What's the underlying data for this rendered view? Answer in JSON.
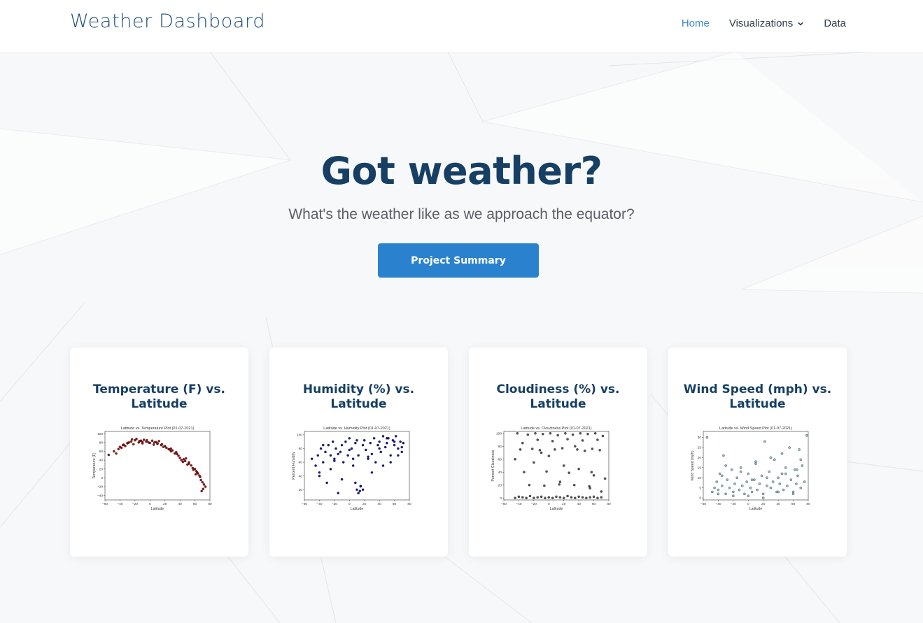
{
  "header": {
    "brand": "Weather Dashboard",
    "nav": [
      {
        "label": "Home",
        "active": true
      },
      {
        "label": "Visualizations",
        "dropdown": true
      },
      {
        "label": "Data"
      }
    ]
  },
  "hero": {
    "title": "Got weather?",
    "subtitle": "What's the weather like as we approach the equator?",
    "cta_label": "Project Summary"
  },
  "colors": {
    "brand": "#1e4d7b",
    "accent": "#2a82cf",
    "heading": "#163f63",
    "nav_active": "#3b87cf"
  },
  "cards": [
    {
      "title_line1": "Temperature (F) vs.",
      "title_line2": "Latitude"
    },
    {
      "title_line1": "Humidity (%) vs.",
      "title_line2": "Latitude"
    },
    {
      "title_line1": "Cloudiness (%) vs.",
      "title_line2": "Latitude"
    },
    {
      "title_line1": "Wind Speed (mph) vs.",
      "title_line2": "Latitude"
    }
  ],
  "chart_data": [
    {
      "type": "scatter",
      "title": "Latitude vs. Temperature Plot (01-07-2021)",
      "xlabel": "Latitude",
      "ylabel": "Temperature (F)",
      "xlim": [
        -60,
        80
      ],
      "ylim": [
        -50,
        105
      ],
      "xticks": [
        -60,
        -40,
        -20,
        0,
        20,
        40,
        60,
        80
      ],
      "yticks": [
        -40,
        -20,
        0,
        20,
        40,
        60,
        80,
        100
      ],
      "marker_color": "#8b0000",
      "x": [
        -55,
        -48,
        -45,
        -42,
        -40,
        -38,
        -35,
        -33,
        -30,
        -28,
        -25,
        -22,
        -20,
        -18,
        -15,
        -12,
        -10,
        -8,
        -5,
        -2,
        0,
        3,
        5,
        8,
        10,
        12,
        15,
        18,
        20,
        22,
        25,
        28,
        30,
        33,
        35,
        38,
        40,
        42,
        45,
        47,
        50,
        52,
        55,
        57,
        60,
        62,
        64,
        66,
        68,
        70,
        72,
        74,
        -36,
        -24,
        -14,
        -4,
        6,
        16,
        26,
        36,
        44,
        52,
        58,
        63,
        67,
        71,
        -30,
        -10,
        10,
        28,
        48,
        61,
        69
      ],
      "y": [
        52,
        60,
        55,
        65,
        70,
        68,
        75,
        72,
        78,
        80,
        82,
        76,
        85,
        88,
        80,
        84,
        78,
        86,
        82,
        80,
        79,
        84,
        75,
        81,
        77,
        83,
        74,
        70,
        72,
        68,
        65,
        60,
        62,
        55,
        58,
        50,
        45,
        40,
        42,
        38,
        30,
        35,
        28,
        22,
        20,
        15,
        10,
        5,
        -5,
        -10,
        -15,
        -20,
        74,
        87,
        83,
        85,
        80,
        76,
        64,
        54,
        36,
        32,
        18,
        12,
        2,
        -25,
        79,
        81,
        78,
        66,
        44,
        8,
        -30
      ]
    },
    {
      "type": "scatter",
      "title": "Latitude vs. Humidity Plot (01-07-2021)",
      "xlabel": "Latitude",
      "ylabel": "Percent Humidity",
      "xlim": [
        -60,
        80
      ],
      "ylim": [
        5,
        105
      ],
      "xticks": [
        -60,
        -40,
        -20,
        0,
        20,
        40,
        60,
        80
      ],
      "yticks": [
        20,
        40,
        60,
        80,
        100
      ],
      "marker_color": "#00008b",
      "x": [
        -50,
        -45,
        -42,
        -40,
        -38,
        -35,
        -32,
        -30,
        -28,
        -25,
        -22,
        -20,
        -18,
        -15,
        -12,
        -10,
        -8,
        -5,
        -2,
        0,
        3,
        5,
        8,
        10,
        12,
        15,
        18,
        20,
        22,
        25,
        28,
        30,
        33,
        35,
        38,
        40,
        42,
        45,
        48,
        50,
        52,
        55,
        58,
        60,
        62,
        65,
        68,
        70,
        72,
        -40,
        -25,
        -10,
        5,
        12,
        18,
        30,
        45,
        55,
        65,
        -35,
        -15,
        0,
        10,
        15,
        25,
        40,
        50,
        60,
        70,
        -20,
        8,
        14
      ],
      "y": [
        65,
        55,
        70,
        45,
        80,
        60,
        75,
        30,
        85,
        70,
        90,
        65,
        80,
        15,
        75,
        85,
        60,
        90,
        70,
        95,
        80,
        55,
        88,
        20,
        70,
        25,
        85,
        92,
        78,
        65,
        88,
        72,
        95,
        60,
        85,
        90,
        75,
        98,
        82,
        88,
        95,
        70,
        92,
        85,
        98,
        80,
        90,
        75,
        88,
        40,
        50,
        35,
        65,
        15,
        20,
        45,
        55,
        60,
        70,
        85,
        72,
        78,
        92,
        25,
        68,
        80,
        95,
        90,
        82,
        62,
        30,
        18
      ]
    },
    {
      "type": "scatter",
      "title": "Latitude vs. Cloudiness Plot (01-07-2021)",
      "xlabel": "Latitude",
      "ylabel": "Percent Cloudiness",
      "xlim": [
        -60,
        80
      ],
      "ylim": [
        -3,
        103
      ],
      "xticks": [
        -60,
        -40,
        -20,
        0,
        20,
        40,
        60,
        80
      ],
      "yticks": [
        0,
        20,
        40,
        60,
        80,
        100
      ],
      "marker_color": "#444444",
      "x": [
        -45,
        -40,
        -35,
        -30,
        -25,
        -20,
        -15,
        -10,
        -5,
        0,
        5,
        10,
        15,
        20,
        25,
        30,
        35,
        40,
        45,
        50,
        55,
        60,
        65,
        70,
        -42,
        -28,
        -18,
        -8,
        2,
        12,
        22,
        32,
        42,
        52,
        62,
        72,
        -38,
        -22,
        -12,
        8,
        18,
        38,
        48,
        58,
        68,
        -33,
        -3,
        27,
        57,
        -26,
        -6,
        14,
        34,
        54,
        -15,
        5,
        25,
        45,
        65,
        -45,
        -20,
        0,
        20,
        40,
        60,
        75,
        -35,
        -10,
        15,
        35,
        55,
        70
      ],
      "y": [
        0,
        2,
        1,
        0,
        3,
        0,
        1,
        2,
        0,
        1,
        0,
        2,
        1,
        0,
        3,
        1,
        0,
        2,
        1,
        0,
        1,
        2,
        0,
        1,
        100,
        98,
        100,
        99,
        100,
        97,
        100,
        98,
        100,
        99,
        100,
        96,
        75,
        76,
        74,
        75,
        77,
        75,
        73,
        76,
        74,
        40,
        41,
        39,
        40,
        20,
        19,
        21,
        20,
        18,
        90,
        88,
        91,
        89,
        90,
        60,
        55,
        65,
        50,
        45,
        35,
        30,
        85,
        70,
        25,
        80,
        15,
        10
      ]
    },
    {
      "type": "scatter",
      "title": "Latitude vs. Wind Speed Plot (01-07-2021)",
      "xlabel": "Latitude",
      "ylabel": "Wind Speed (mph)",
      "xlim": [
        -60,
        80
      ],
      "ylim": [
        -1,
        33
      ],
      "xticks": [
        -60,
        -40,
        -20,
        0,
        20,
        40,
        60,
        80
      ],
      "yticks": [
        0,
        5,
        10,
        15,
        20,
        25,
        30
      ],
      "marker_color": "#87b7c8",
      "x": [
        -55,
        -48,
        -45,
        -42,
        -40,
        -38,
        -35,
        -33,
        -30,
        -28,
        -25,
        -22,
        -20,
        -18,
        -15,
        -12,
        -10,
        -8,
        -5,
        -2,
        0,
        3,
        5,
        8,
        10,
        12,
        15,
        18,
        20,
        22,
        25,
        28,
        30,
        33,
        35,
        38,
        40,
        42,
        45,
        47,
        50,
        52,
        55,
        57,
        60,
        62,
        64,
        66,
        68,
        70,
        72,
        75,
        78,
        -40,
        -20,
        0,
        20,
        40,
        60,
        -30,
        -10,
        10,
        30,
        50,
        70,
        -35,
        5,
        25,
        45,
        65
      ],
      "y": [
        30,
        3,
        5,
        8,
        4,
        12,
        6,
        21,
        2,
        9,
        5,
        14,
        3,
        7,
        10,
        4,
        15,
        6,
        2,
        8,
        12,
        5,
        3,
        9,
        18,
        4,
        7,
        11,
        2,
        28,
        6,
        13,
        5,
        8,
        19,
        3,
        10,
        7,
        22,
        4,
        12,
        6,
        25,
        9,
        3,
        14,
        7,
        11,
        24,
        5,
        16,
        8,
        31,
        2,
        1,
        1,
        0,
        3,
        2,
        16,
        13,
        17,
        20,
        15,
        19,
        11,
        9,
        10,
        12,
        14
      ]
    }
  ]
}
